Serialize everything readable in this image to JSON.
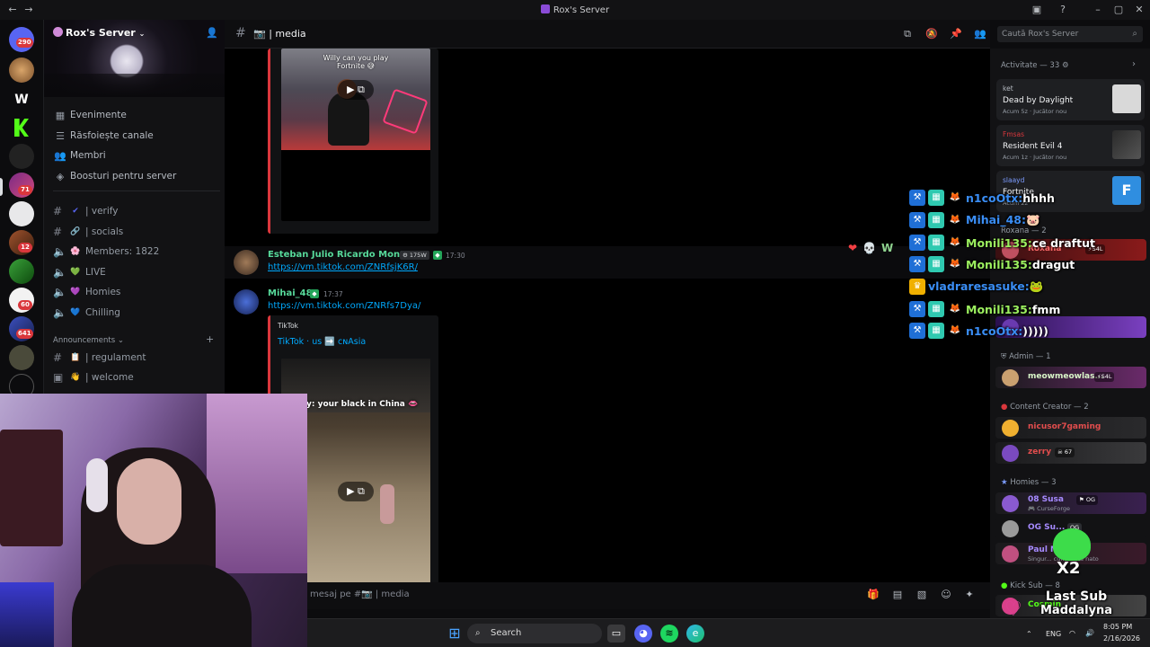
{
  "window": {
    "title": "Rox's Server"
  },
  "rail": {
    "badges": [
      "290",
      "71",
      "12",
      "60",
      "641"
    ],
    "guild_logo_text": "W"
  },
  "server": {
    "name": "Rox's Server",
    "menu": [
      {
        "label": "Evenimente",
        "icon": "calendar-icon"
      },
      {
        "label": "Răsfoiește canale",
        "icon": "browse-icon"
      },
      {
        "label": "Membri",
        "icon": "members-icon"
      },
      {
        "label": "Boosturi pentru server",
        "icon": "boost-icon"
      }
    ],
    "channels": [
      {
        "label": "| verify",
        "emoji": "✔"
      },
      {
        "label": "| socials",
        "emoji": "🔗"
      },
      {
        "label": "Members: 1822",
        "emoji": "🌸"
      },
      {
        "label": "LIVE",
        "emoji": "💚"
      },
      {
        "label": "Homies",
        "emoji": "💜"
      },
      {
        "label": "Chilling",
        "emoji": "💙"
      }
    ],
    "category": "Announcements",
    "announcements": [
      {
        "label": "| regulament",
        "emoji": "📋"
      },
      {
        "label": "| welcome",
        "emoji": "👋"
      }
    ]
  },
  "chat": {
    "channel": "| media",
    "search_placeholder": "Caută Rox's Server",
    "embed1": {
      "caption_line1": "Willy can you play",
      "caption_line2": "Fortnite"
    },
    "msg1": {
      "author": "Esteban Julio Ricardo Montoya",
      "tag": "175W",
      "time": "17:30",
      "link": "https://vm.tiktok.com/ZNRfsjK6R/"
    },
    "msg2": {
      "author": "Mihai_48",
      "time": "17:37",
      "link": "https://vm.tiktok.com/ZNRfs7Dya/"
    },
    "embed2": {
      "provider": "TikTok",
      "title": "TikTok · us ➡️ ᴄɴAsia",
      "caption": "y: your black in China"
    },
    "reactions": [
      "❤",
      "💀",
      "W"
    ],
    "composer_placeholder": "mesaj pe #📷 | media"
  },
  "members": {
    "activity_header": "Activitate — 33",
    "activities": [
      {
        "user": "ket",
        "game": "Dead by Daylight",
        "meta": "Acum 5z · Jucător nou"
      },
      {
        "user": "Fmsas",
        "game": "Resident Evil 4",
        "meta": "Acum 1z · Jucător nou"
      },
      {
        "user": "slaayd",
        "game": "Fortnite",
        "meta": "Acum 2z"
      }
    ],
    "roxana_header": "Roxana — 2",
    "roxana_user": "Roxana",
    "roxana_tag": "S4L",
    "admin_header": "Admin — 1",
    "admin_user": "meowmeowlas...",
    "admin_tag": "S4L",
    "creator_header": "Content Creator — 2",
    "creators": [
      {
        "name": "nicusor7gaming",
        "color": "#e24d4d"
      },
      {
        "name": "zerry",
        "color": "#e24d4d",
        "tag": "67"
      }
    ],
    "homies_header": "Homies — 3",
    "homies": [
      {
        "name": "08 Susa",
        "tag": "OG",
        "sub": "CurseForge"
      },
      {
        "name": "OG Su...",
        "tag": "OG",
        "sub": ""
      },
      {
        "name": "Paul M...",
        "tag": "",
        "sub": "Singur... cunoscută nato"
      }
    ],
    "kick_header": "Kick Sub — 8",
    "kick_user": "Cosmin"
  },
  "overlay": {
    "lines": [
      {
        "user": "n1coOtx:",
        "msg": "hhhh",
        "color": "#3a8ef6"
      },
      {
        "user": "Mihai_48:",
        "msg": "🐷",
        "color": "#3a8ef6"
      },
      {
        "user": "Monili135:",
        "msg": "ce draftut",
        "color": "#9cf05f"
      },
      {
        "user": "Monili135:",
        "msg": "dragut",
        "color": "#9cf05f"
      },
      {
        "user": "vladraresasuke:",
        "msg": "🐸",
        "color": "#3a8ef6"
      },
      {
        "user": "Monili135:",
        "msg": "fmm",
        "color": "#9cf05f"
      },
      {
        "user": "n1coOtx:",
        "msg": ")))))",
        "color": "#3a8ef6"
      }
    ],
    "last_sub_label": "Last Sub",
    "last_sub_name": "Maddalyna",
    "multiplier": "X2"
  },
  "taskbar": {
    "search": "Search",
    "lang": "ENG",
    "time": "8:05 PM",
    "date": "2/16/2026"
  },
  "colors": {
    "accent": "#5865f2",
    "link": "#00a8fc",
    "online": "#23a559",
    "embed_border": "#da373c"
  }
}
